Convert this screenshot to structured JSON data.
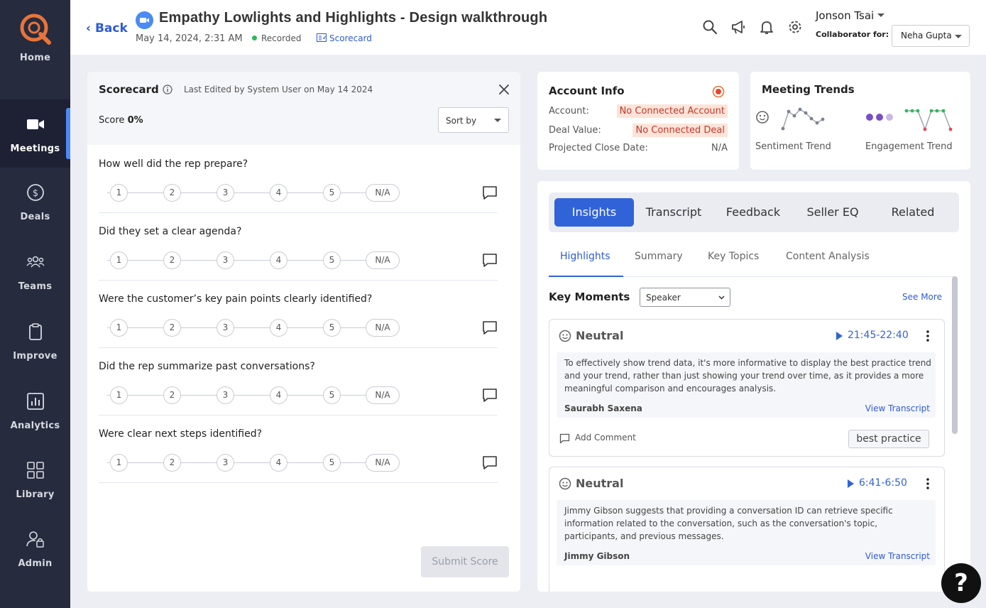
{
  "sidebar": {
    "home": "Home",
    "items": [
      {
        "label": "Meetings",
        "icon": "video-camera-icon"
      },
      {
        "label": "Deals",
        "icon": "dollar-icon"
      },
      {
        "label": "Teams",
        "icon": "team-icon"
      },
      {
        "label": "Improve",
        "icon": "clipboard-icon"
      },
      {
        "label": "Analytics",
        "icon": "analytics-icon"
      },
      {
        "label": "Library",
        "icon": "grid-icon"
      },
      {
        "label": "Admin",
        "icon": "admin-icon"
      }
    ],
    "active": "Meetings"
  },
  "header": {
    "back": "Back",
    "title": "Empathy Lowlights and Highlights - Design walkthrough",
    "date": "May 14, 2024, 2:31 AM",
    "recorded": "Recorded",
    "scorecard_link": "Scorecard",
    "user_name": "Jonson Tsai",
    "collab_label": "Collaborator for:",
    "collab_value": "Neha Gupta"
  },
  "scorecard": {
    "title": "Scorecard",
    "edited": "Last Edited by System User on May 14 2024",
    "score_label": "Score",
    "score_value": "0%",
    "sort_by": "Sort by",
    "options": [
      "1",
      "2",
      "3",
      "4",
      "5"
    ],
    "na": "N/A",
    "questions": [
      "How well did the rep prepare?",
      "Did they set a clear agenda?",
      "Were the customer’s key pain points clearly identified?",
      "Did the rep summarize past conversations?",
      "Were clear next steps identified?"
    ],
    "submit": "Submit Score"
  },
  "account": {
    "title": "Account Info",
    "account_label": "Account:",
    "account_value": "No Connected Account",
    "deal_label": "Deal Value:",
    "deal_value": "No Connected Deal",
    "close_label": "Projected Close Date:",
    "close_value": "N/A"
  },
  "trends": {
    "title": "Meeting Trends",
    "sentiment": "Sentiment Trend",
    "engagement": "Engagement Trend"
  },
  "insights": {
    "tabs": [
      "Insights",
      "Transcript",
      "Feedback",
      "Seller EQ",
      "Related"
    ],
    "subtabs": [
      "Highlights",
      "Summary",
      "Key Topics",
      "Content Analysis"
    ],
    "key_moments": "Key Moments",
    "speaker_select": "Speaker",
    "see_more": "See More",
    "view_transcript": "View Transcript",
    "add_comment": "Add Comment",
    "moments": [
      {
        "sentiment": "Neutral",
        "time": "21:45-22:40",
        "text": "To effectively show trend data, it's more informative to display the best practice trend and your trend, rather than just showing your trend over time, as it provides a more meaningful comparison and encourages analysis.",
        "speaker": "Saurabh Saxena",
        "tag": "best practice"
      },
      {
        "sentiment": "Neutral",
        "time": "6:41-6:50",
        "text": "Jimmy Gibson suggests that providing a conversation ID can retrieve specific information related to the conversation, such as the conversation's topic, participants, and previous messages.",
        "speaker": "Jimmy Gibson",
        "tag": ""
      }
    ]
  },
  "colors": {
    "sidebar_bg": "#262b3e",
    "accent": "#3163d8",
    "brand": "#e8743b"
  }
}
